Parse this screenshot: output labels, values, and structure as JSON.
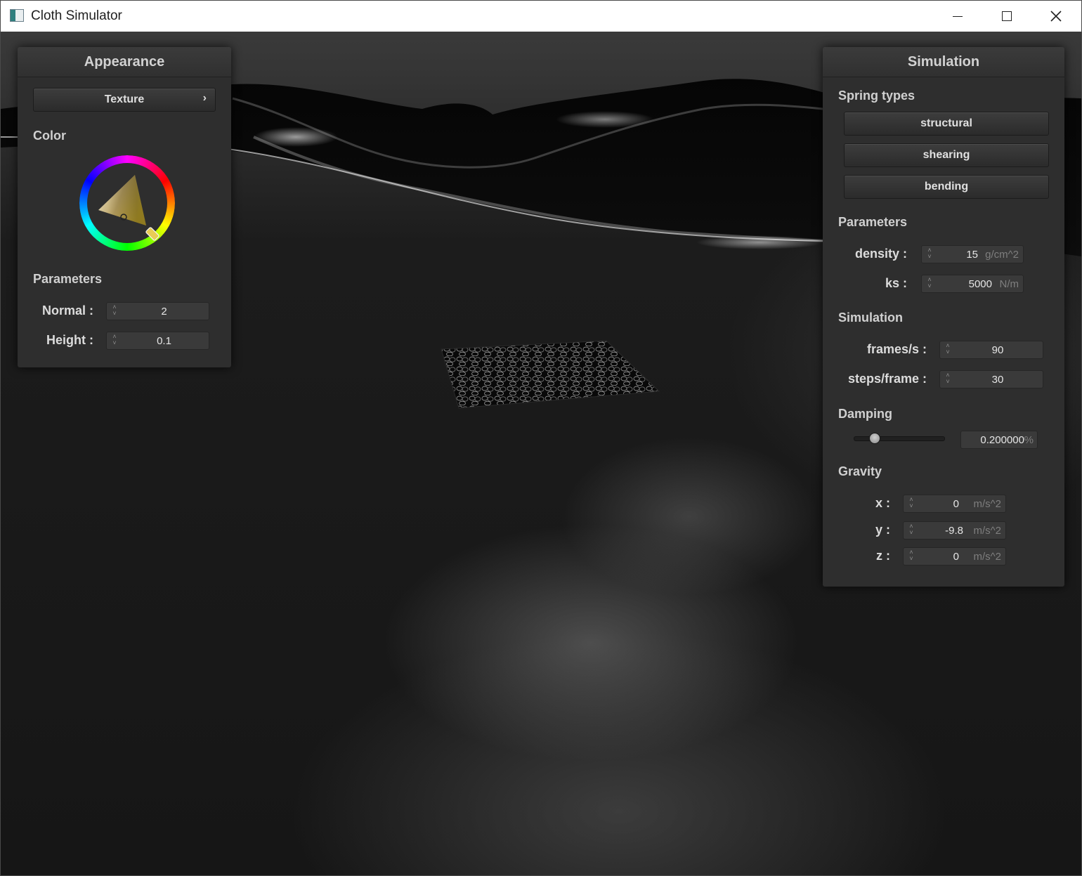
{
  "window": {
    "title": "Cloth Simulator",
    "controls": [
      "minimize",
      "maximize",
      "close"
    ]
  },
  "appearance": {
    "header": "Appearance",
    "texture_button": "Texture",
    "color_section": "Color",
    "selected_color": "#b8a060",
    "params_section": "Parameters",
    "normal_label": "Normal :",
    "normal_value": "2",
    "height_label": "Height :",
    "height_value": "0.1"
  },
  "simulation": {
    "header": "Simulation",
    "spring_section": "Spring types",
    "spring_buttons": [
      "structural",
      "shearing",
      "bending"
    ],
    "params_section": "Parameters",
    "density_label": "density :",
    "density_value": "15",
    "density_unit": "g/cm^2",
    "ks_label": "ks :",
    "ks_value": "5000",
    "ks_unit": "N/m",
    "sim_section": "Simulation",
    "fps_label": "frames/s :",
    "fps_value": "90",
    "steps_label": "steps/frame :",
    "steps_value": "30",
    "damping_section": "Damping",
    "damping_value": "0.200000",
    "damping_unit": "%",
    "damping_slider_fraction": 0.2,
    "gravity_section": "Gravity",
    "gx_label": "x :",
    "gx_value": "0",
    "gy_label": "y :",
    "gy_value": "-9.8",
    "gz_label": "z :",
    "gz_value": "0",
    "gravity_unit": "m/s^2"
  }
}
